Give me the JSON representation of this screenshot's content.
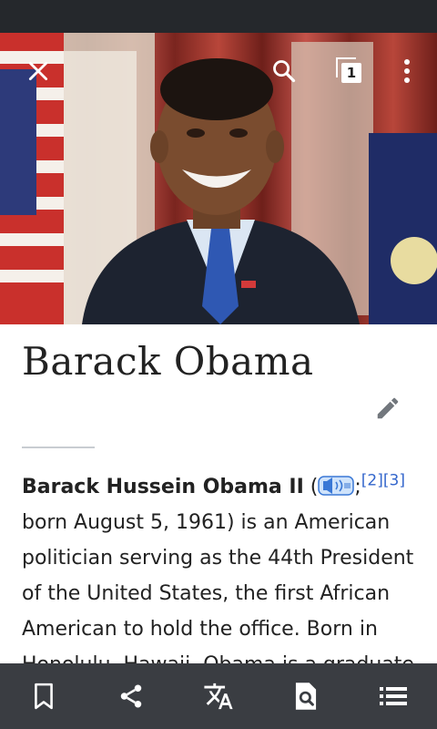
{
  "article": {
    "title": "Barack Obama",
    "lead_bold": "Barack Hussein Obama II",
    "paren_open": " (",
    "semicolon": ";",
    "cite_2": "[2]",
    "cite_3": "[3]",
    "lead_text": " born August 5, 1961) is an American politician serving as the 44th President of the United States, the first African American to hold the office. Born in Honolulu, Hawaii, Obama is a graduate"
  },
  "toolbar": {
    "tabs_count": "1"
  },
  "icons": {
    "close": "close-icon",
    "search": "search-icon",
    "tabs": "tabs-icon",
    "overflow": "more-vert-icon",
    "edit": "pencil-icon",
    "audio": "audio-pronunciation-icon",
    "bottom": [
      "bookmark-icon",
      "share-icon",
      "translate-icon",
      "find-in-page-icon",
      "contents-list-icon"
    ]
  },
  "colors": {
    "status_bar": "#25282c",
    "bottom_bar": "#3a3d42",
    "link": "#3366cc",
    "text": "#222222"
  }
}
